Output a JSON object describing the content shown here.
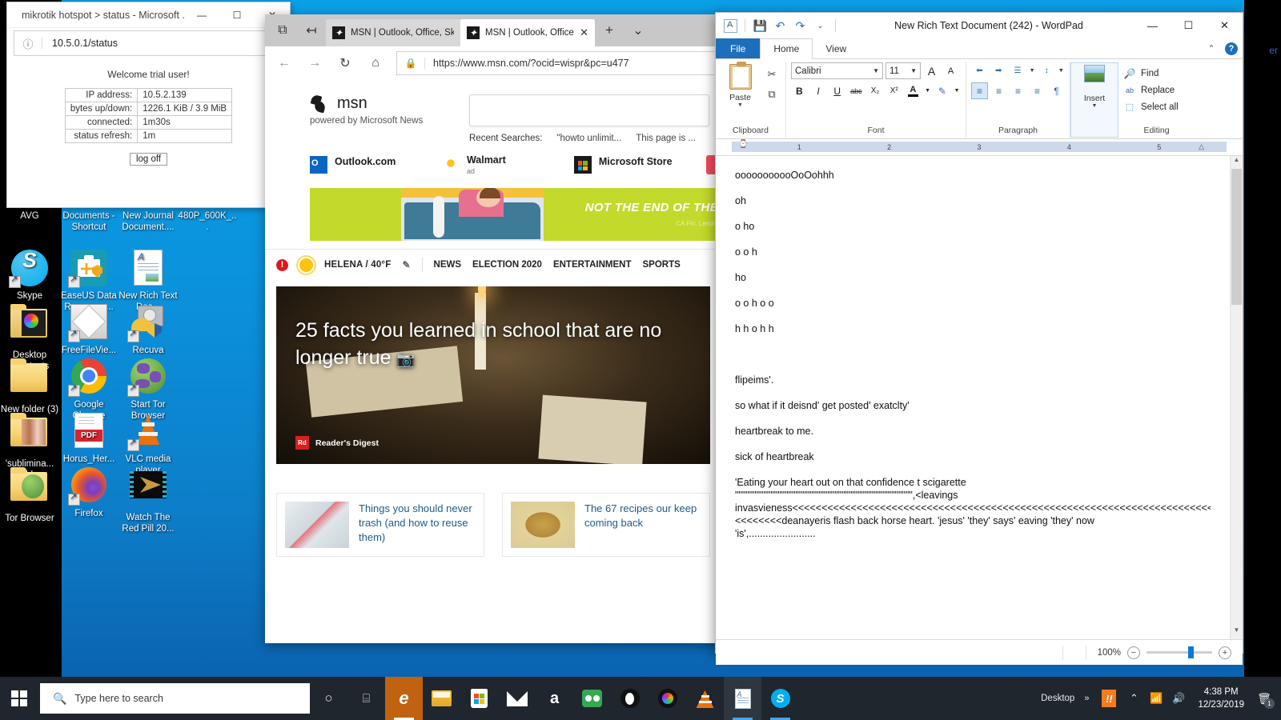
{
  "desktop": {
    "icons": [
      {
        "label": "AVG",
        "type": "app"
      },
      {
        "label": "Documents - Shortcut",
        "type": "shortcut"
      },
      {
        "label": "New Journal Document....",
        "type": "doc"
      },
      {
        "label": "480P_600K_...",
        "type": "video"
      },
      {
        "label": "Skype",
        "type": "app"
      },
      {
        "label": "EaseUS Data Recovery ...",
        "type": "app"
      },
      {
        "label": "New Rich Text Doc...",
        "type": "doc"
      },
      {
        "label": "Desktop Shortcuts",
        "type": "folder"
      },
      {
        "label": "FreeFileVie...",
        "type": "app"
      },
      {
        "label": "Recuva",
        "type": "app"
      },
      {
        "label": "New folder (3)",
        "type": "folder"
      },
      {
        "label": "Google Chrome",
        "type": "app"
      },
      {
        "label": "Start Tor Browser",
        "type": "app"
      },
      {
        "label": "'sublimina... folder",
        "type": "folder"
      },
      {
        "label": "Horus_Her...",
        "type": "pdf"
      },
      {
        "label": "VLC media player",
        "type": "app"
      },
      {
        "label": "Tor Browser",
        "type": "folder"
      },
      {
        "label": "Firefox",
        "type": "app"
      },
      {
        "label": "Watch The Red Pill 20...",
        "type": "video"
      }
    ]
  },
  "mikrotik": {
    "window_title": "mikrotik hotspot > status - Microsoft ...",
    "minimize": "—",
    "maximize": "☐",
    "close": "✕",
    "url": "10.5.0.1/status",
    "welcome": "Welcome trial user!",
    "rows": [
      {
        "key": "IP address:",
        "value": "10.5.2.139"
      },
      {
        "key": "bytes up/down:",
        "value": "1226.1 KiB / 3.9 MiB"
      },
      {
        "key": "connected:",
        "value": "1m30s"
      },
      {
        "key": "status refresh:",
        "value": "1m"
      }
    ],
    "logoff_label": "log off"
  },
  "edge": {
    "tabs": [
      {
        "label": "MSN | Outlook, Office, Skyp",
        "active": false
      },
      {
        "label": "MSN | Outlook, Office, S",
        "active": true
      }
    ],
    "new_tab": "+",
    "tab_close": "✕",
    "tab_menu": "⌄",
    "back": "←",
    "forward": "→",
    "refresh": "↻",
    "home": "⌂",
    "lock": "🔒",
    "url": "https://www.msn.com/?ocid=wispr&pc=u477",
    "msn": {
      "logo_word": "msn",
      "powered_by": "powered by Microsoft News",
      "recent_label": "Recent Searches:",
      "recent_items": [
        "\"howto unlimit...",
        "This page is ..."
      ],
      "quick_links": [
        {
          "label": "Outlook.com",
          "ad": ""
        },
        {
          "label": "Walmart",
          "ad": "ad"
        },
        {
          "label": "Microsoft Store",
          "ad": ""
        }
      ],
      "ad_headline": "NOT THE END OF THE",
      "ad_disclaimer": "CA Fin. Lende",
      "weather": "HELENA / 40°F",
      "nav": [
        "NEWS",
        "ELECTION 2020",
        "ENTERTAINMENT",
        "SPORTS"
      ],
      "hero_title": "25 facts you learned in school that are no longer true",
      "hero_camera": "📷",
      "hero_source": "Reader's Digest",
      "hero_source_badge": "Rd",
      "cards": [
        {
          "title": "Things you should never trash (and how to reuse them)"
        },
        {
          "title": "The 67 recipes our keep coming back"
        }
      ]
    }
  },
  "wordpad": {
    "title": "New Rich Text Document (242) - WordPad",
    "qat": {
      "save": "💾",
      "undo": "↶",
      "redo": "↷",
      "customize": "⌄"
    },
    "minimize": "—",
    "maximize": "☐",
    "close": "✕",
    "collapse_ribbon": "⌃",
    "help": "?",
    "tabs": {
      "file": "File",
      "home": "Home",
      "view": "View"
    },
    "ribbon": {
      "clipboard": {
        "label": "Clipboard",
        "paste": "Paste",
        "paste_arrow": "▼",
        "cut": "✂",
        "copy": "⧉"
      },
      "font": {
        "label": "Font",
        "family": "Calibri",
        "size": "11",
        "grow": "A",
        "shrink": "A",
        "bold": "B",
        "italic": "I",
        "underline": "U",
        "strikethrough": "abc",
        "subscript": "X₂",
        "superscript": "X²",
        "text_color": "A",
        "highlight": "✎"
      },
      "paragraph": {
        "label": "Paragraph",
        "decrease_indent": "⬅",
        "increase_indent": "➡",
        "bullets": "☰",
        "line_spacing": "↕",
        "align_left": "≡",
        "align_center": "≡",
        "align_right": "≡",
        "justify": "≡",
        "paragraph_marks": "¶"
      },
      "insert": {
        "label": "Insert",
        "insert": "Insert",
        "arrow": "▼"
      },
      "editing": {
        "label": "Editing",
        "find": "Find",
        "replace": "Replace",
        "select_all": "Select all",
        "find_icon": "🔍",
        "replace_icon": "ab",
        "select_icon": "⬚"
      }
    },
    "ruler_marks": [
      "1",
      "2",
      "3",
      "4",
      "5"
    ],
    "document": {
      "paragraphs": [
        "ooooooooooOoOohhh",
        "oh",
        "o ho",
        "o o h",
        "ho",
        "o o h o o",
        "h h o h h",
        "",
        "flipeims'.",
        "so what if it deisnd' get posted' exatclty'",
        "heartbreak to me.",
        "sick of heartbreak"
      ],
      "block": [
        "'Eating your heart out on that confidence t scigarette",
        "\"\"\"\"\"\"\"\"\"\"\"\"\"\"\"\"\"\"\"\"\"\"\"\"\"\"\"\"\"\"\"\"\"\"\"\"\"\"\"\"\"\"\"\"\"\"\"\"\"\",<leavings",
        "invasvieness<<<<<<<<<<<<<<<<<<<<<<<<<<<<<<<<<<<<<<<<<<<<<<<<<<<<<<<<<<<<<<<<<<<<<<<<<<<<<<<<<<<<<<<<<<<<<<<<<<<<<<<<<<<<<<<<<<<<<<<<<<<<<<<<<<<<<<<<<<<<<<<<<<<<<<<<<<<<<<<<<<<<<<<<<<<<<<<<<<<<<<<<<<<<<<<<<<<<<<<<<<<<<<<<<<<<<<<<<<<<<<<<<<<<<<<<<<<<<<<<<<<<<<<<<<<<<<",
        "<<<<<<<<deanayeris flash back horse heart. 'jesus' 'they' says' eaving 'they' now",
        "'is',........................"
      ]
    },
    "status": {
      "zoom_label": "100%",
      "zoom_out": "−",
      "zoom_in": "+"
    }
  },
  "taskbar": {
    "search_placeholder": "Type here to search",
    "search_icon": "🔍",
    "cortana": "○",
    "taskview": "⌸",
    "pinned": [
      "edge",
      "file-explorer",
      "microsoft-store",
      "mail",
      "amazon",
      "tripadvisor",
      "opera",
      "colorwheel",
      "vlc",
      "wordpad",
      "skype"
    ],
    "show_desktop": "Desktop",
    "tray_expand": "»",
    "tray_chevron": "⌃",
    "time": "4:38 PM",
    "date": "12/23/2019",
    "notification_count": "1"
  },
  "hidden_window_fragment": "er"
}
